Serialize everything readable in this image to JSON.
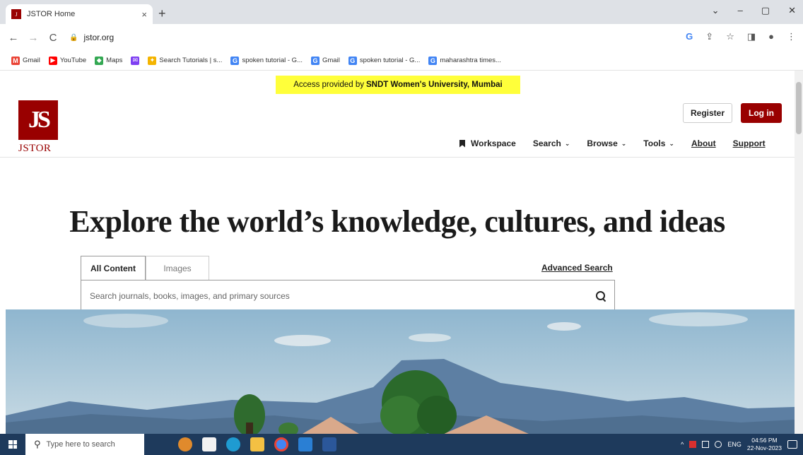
{
  "browser": {
    "tab_title": "JSTOR Home",
    "tab_close": "×",
    "new_tab": "+",
    "url": "jstor.org",
    "window_controls": {
      "dropdown": "⌄",
      "minimize": "–",
      "maximize": "▢",
      "close": "✕"
    },
    "toolbar_icons": {
      "google": "G",
      "share": "⇪",
      "star": "☆",
      "sidebar": "◨",
      "profile": "●",
      "menu": "⋮"
    },
    "nav": {
      "back": "←",
      "forward": "→",
      "reload": "C",
      "lock": "🔒"
    }
  },
  "bookmarks": [
    {
      "label": "Gmail",
      "icon": "M",
      "color": "#ea4335"
    },
    {
      "label": "YouTube",
      "icon": "▶",
      "color": "#ff0000"
    },
    {
      "label": "Maps",
      "icon": "◆",
      "color": "#34a853"
    },
    {
      "label": "",
      "icon": "✉",
      "color": "#7e3ff2"
    },
    {
      "label": "Search Tutorials | s...",
      "icon": "✦",
      "color": "#f4b400"
    },
    {
      "label": "spoken tutorial - G...",
      "icon": "G",
      "color": "#4285f4"
    },
    {
      "label": "Gmail",
      "icon": "G",
      "color": "#4285f4"
    },
    {
      "label": "spoken tutorial - G...",
      "icon": "G",
      "color": "#4285f4"
    },
    {
      "label": "maharashtra times...",
      "icon": "G",
      "color": "#4285f4"
    }
  ],
  "page": {
    "access_prefix": "Access provided by",
    "access_org": "SNDT Women's University, Mumbai",
    "logo_mark": "JS",
    "logo_text": "JSTOR",
    "register": "Register",
    "login": "Log in",
    "nav": {
      "workspace": "Workspace",
      "search": "Search",
      "browse": "Browse",
      "tools": "Tools",
      "about": "About",
      "support": "Support",
      "chevron": "⌄"
    },
    "headline": "Explore the world’s knowledge, cultures, and ideas",
    "search": {
      "tab_all": "All Content",
      "tab_images": "Images",
      "advanced": "Advanced Search",
      "placeholder": "Search journals, books, images, and primary sources",
      "value": ""
    }
  },
  "taskbar": {
    "search_placeholder": "Type here to search",
    "search_glyph": "⚲",
    "tray_chevron": "^",
    "language": "ENG",
    "time": "04:56 PM",
    "date": "22-Nov-2023"
  },
  "colors": {
    "brand": "#990000",
    "banner": "#ffff3a",
    "taskbar": "#1e3a5c"
  }
}
